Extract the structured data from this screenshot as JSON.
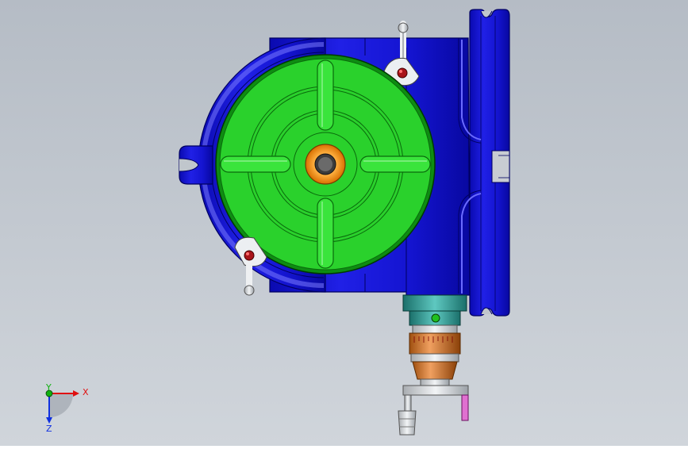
{
  "triad": {
    "x_label": "X",
    "y_label": "Y",
    "z_label": "Z"
  },
  "colors": {
    "background_top": "#b7bec6",
    "background_bottom": "#cfd4da",
    "housing": "#1a1adc",
    "housing_dark": "#0a0a9c",
    "table": "#29d12b",
    "table_dark": "#0e8c12",
    "center_ring": "#f0900e",
    "lock_red": "#a8141a",
    "axis_x": "#e01010",
    "axis_y": "#10b010",
    "axis_z": "#1030e0"
  }
}
